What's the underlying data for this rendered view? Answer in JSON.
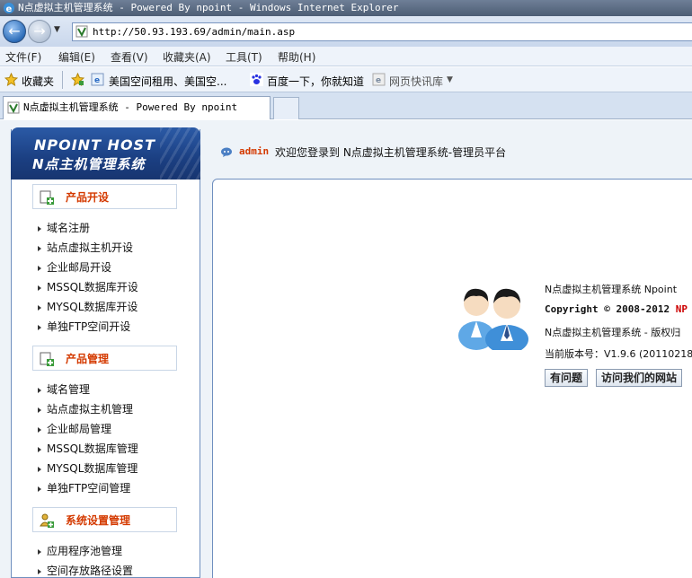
{
  "window": {
    "title": "N点虚拟主机管理系统 - Powered By npoint - Windows Internet Explorer"
  },
  "address": {
    "url": "http://50.93.193.69/admin/main.asp"
  },
  "menubar": {
    "items": [
      "文件(F)",
      "编辑(E)",
      "查看(V)",
      "收藏夹(A)",
      "工具(T)",
      "帮助(H)"
    ]
  },
  "favorites": {
    "label": "收藏夹",
    "links": [
      "美国空间租用、美国空...",
      "百度一下，你就知道",
      "网页快讯库"
    ]
  },
  "tab": {
    "title": "N点虚拟主机管理系统 - Powered By npoint"
  },
  "logo": {
    "line1": "NPOINT HOST",
    "line2": "N点主机管理系统"
  },
  "sidebar": {
    "sections": [
      {
        "title": "产品开设",
        "items": [
          "域名注册",
          "站点虚拟主机开设",
          "企业邮局开设",
          "MSSQL数据库开设",
          "MYSQL数据库开设",
          "单独FTP空间开设"
        ]
      },
      {
        "title": "产品管理",
        "items": [
          "域名管理",
          "站点虚拟主机管理",
          "企业邮局管理",
          "MSSQL数据库管理",
          "MYSQL数据库管理",
          "单独FTP空间管理"
        ]
      },
      {
        "title": "系统设置管理",
        "items": [
          "应用程序池管理",
          "空间存放路径设置"
        ]
      }
    ]
  },
  "welcome": {
    "user": "admin",
    "message": "欢迎您登录到 N点虚拟主机管理系统-管理员平台"
  },
  "info": {
    "product": "N点虚拟主机管理系统 Npoint",
    "copyright_prefix": "Copyright © 2008-2012 ",
    "copyright_brand": "NP",
    "rights": "N点虚拟主机管理系统 - 版权归",
    "version": "当前版本号：V1.9.6 (20110218)"
  },
  "buttons": {
    "question": "有问题",
    "visit": "访问我们的网站"
  },
  "colors": {
    "accent_red": "#d43a00",
    "sidebar_border": "#6f8fbf",
    "logo_blue": "#1b3f82"
  }
}
